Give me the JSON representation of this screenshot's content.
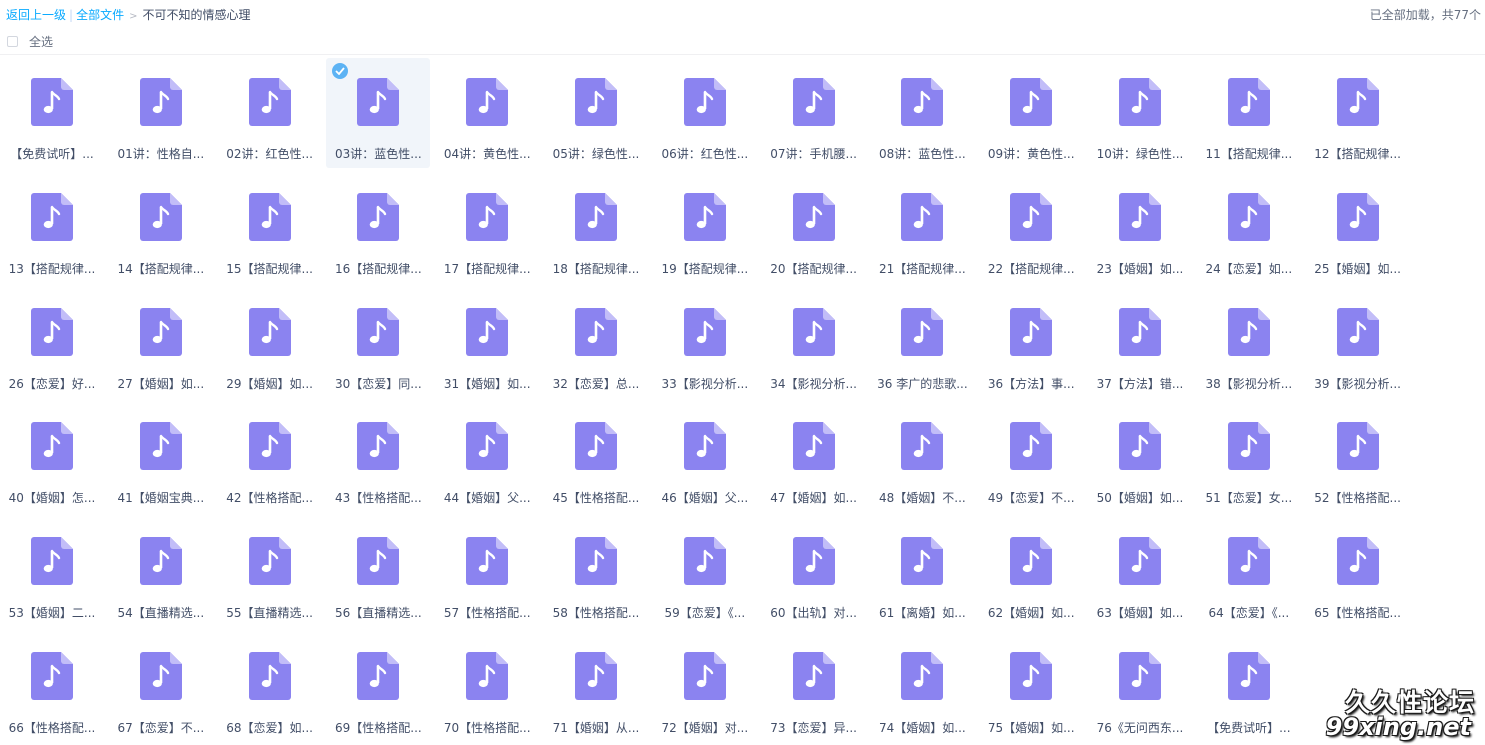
{
  "breadcrumb": {
    "back_label": "返回上一级",
    "separator": "|",
    "root_label": "全部文件",
    "arrow": ">",
    "current_label": "不可不知的情感心理"
  },
  "status": {
    "loaded_text": "已全部加载，共77个"
  },
  "select_all": {
    "label": "全选"
  },
  "colors": {
    "icon_purple": "#8b83f0",
    "icon_fold": "#c2bdf8",
    "link_blue": "#09aaff",
    "check_blue": "#5db3f4"
  },
  "icon_name": "music-file-icon",
  "files": [
    {
      "name": "【免费试听】...",
      "selected": false
    },
    {
      "name": "01讲：性格自...",
      "selected": false
    },
    {
      "name": "02讲：红色性...",
      "selected": false
    },
    {
      "name": "03讲：蓝色性...",
      "selected": true
    },
    {
      "name": "04讲：黄色性...",
      "selected": false
    },
    {
      "name": "05讲：绿色性...",
      "selected": false
    },
    {
      "name": "06讲：红色性...",
      "selected": false
    },
    {
      "name": "07讲：手机腰...",
      "selected": false
    },
    {
      "name": "08讲：蓝色性...",
      "selected": false
    },
    {
      "name": "09讲：黄色性...",
      "selected": false
    },
    {
      "name": "10讲：绿色性...",
      "selected": false
    },
    {
      "name": "11【搭配规律...",
      "selected": false
    },
    {
      "name": "12【搭配规律...",
      "selected": false
    },
    {
      "name": "13【搭配规律...",
      "selected": false
    },
    {
      "name": "14【搭配规律...",
      "selected": false
    },
    {
      "name": "15【搭配规律...",
      "selected": false
    },
    {
      "name": "16【搭配规律...",
      "selected": false
    },
    {
      "name": "17【搭配规律...",
      "selected": false
    },
    {
      "name": "18【搭配规律...",
      "selected": false
    },
    {
      "name": "19【搭配规律...",
      "selected": false
    },
    {
      "name": "20【搭配规律...",
      "selected": false
    },
    {
      "name": "21【搭配规律...",
      "selected": false
    },
    {
      "name": "22【搭配规律...",
      "selected": false
    },
    {
      "name": "23【婚姻】如...",
      "selected": false
    },
    {
      "name": "24【恋爱】如...",
      "selected": false
    },
    {
      "name": "25【婚姻】如...",
      "selected": false
    },
    {
      "name": "26【恋爱】好...",
      "selected": false
    },
    {
      "name": "27【婚姻】如...",
      "selected": false
    },
    {
      "name": "29【婚姻】如...",
      "selected": false
    },
    {
      "name": "30【恋爱】同...",
      "selected": false
    },
    {
      "name": "31【婚姻】如...",
      "selected": false
    },
    {
      "name": "32【恋爱】总...",
      "selected": false
    },
    {
      "name": "33【影视分析...",
      "selected": false
    },
    {
      "name": "34【影视分析...",
      "selected": false
    },
    {
      "name": "36 李广的悲歌...",
      "selected": false
    },
    {
      "name": "36【方法】事...",
      "selected": false
    },
    {
      "name": "37【方法】错...",
      "selected": false
    },
    {
      "name": "38【影视分析...",
      "selected": false
    },
    {
      "name": "39【影视分析...",
      "selected": false
    },
    {
      "name": "40【婚姻】怎...",
      "selected": false
    },
    {
      "name": "41【婚姻宝典...",
      "selected": false
    },
    {
      "name": "42【性格搭配...",
      "selected": false
    },
    {
      "name": "43【性格搭配...",
      "selected": false
    },
    {
      "name": "44【婚姻】父...",
      "selected": false
    },
    {
      "name": "45【性格搭配...",
      "selected": false
    },
    {
      "name": "46【婚姻】父...",
      "selected": false
    },
    {
      "name": "47【婚姻】如...",
      "selected": false
    },
    {
      "name": "48【婚姻】不...",
      "selected": false
    },
    {
      "name": "49【恋爱】不...",
      "selected": false
    },
    {
      "name": "50【婚姻】如...",
      "selected": false
    },
    {
      "name": "51【恋爱】女...",
      "selected": false
    },
    {
      "name": "52【性格搭配...",
      "selected": false
    },
    {
      "name": "53【婚姻】二...",
      "selected": false
    },
    {
      "name": "54【直播精选...",
      "selected": false
    },
    {
      "name": "55【直播精选...",
      "selected": false
    },
    {
      "name": "56【直播精选...",
      "selected": false
    },
    {
      "name": "57【性格搭配...",
      "selected": false
    },
    {
      "name": "58【性格搭配...",
      "selected": false
    },
    {
      "name": "59【恋爱】《...",
      "selected": false
    },
    {
      "name": "60【出轨】对...",
      "selected": false
    },
    {
      "name": "61【离婚】如...",
      "selected": false
    },
    {
      "name": "62【婚姻】如...",
      "selected": false
    },
    {
      "name": "63【婚姻】如...",
      "selected": false
    },
    {
      "name": "64【恋爱】《...",
      "selected": false
    },
    {
      "name": "65【性格搭配...",
      "selected": false
    },
    {
      "name": "66【性格搭配...",
      "selected": false
    },
    {
      "name": "67【恋爱】不...",
      "selected": false
    },
    {
      "name": "68【恋爱】如...",
      "selected": false
    },
    {
      "name": "69【性格搭配...",
      "selected": false
    },
    {
      "name": "70【性格搭配...",
      "selected": false
    },
    {
      "name": "71【婚姻】从...",
      "selected": false
    },
    {
      "name": "72【婚姻】对...",
      "selected": false
    },
    {
      "name": "73【恋爱】异...",
      "selected": false
    },
    {
      "name": "74【婚姻】如...",
      "selected": false
    },
    {
      "name": "75【婚姻】如...",
      "selected": false
    },
    {
      "name": "76《无问西东...",
      "selected": false
    },
    {
      "name": "【免费试听】...",
      "selected": false
    }
  ],
  "watermark": {
    "line1": "久久性论坛",
    "line2": "99xing.net"
  }
}
